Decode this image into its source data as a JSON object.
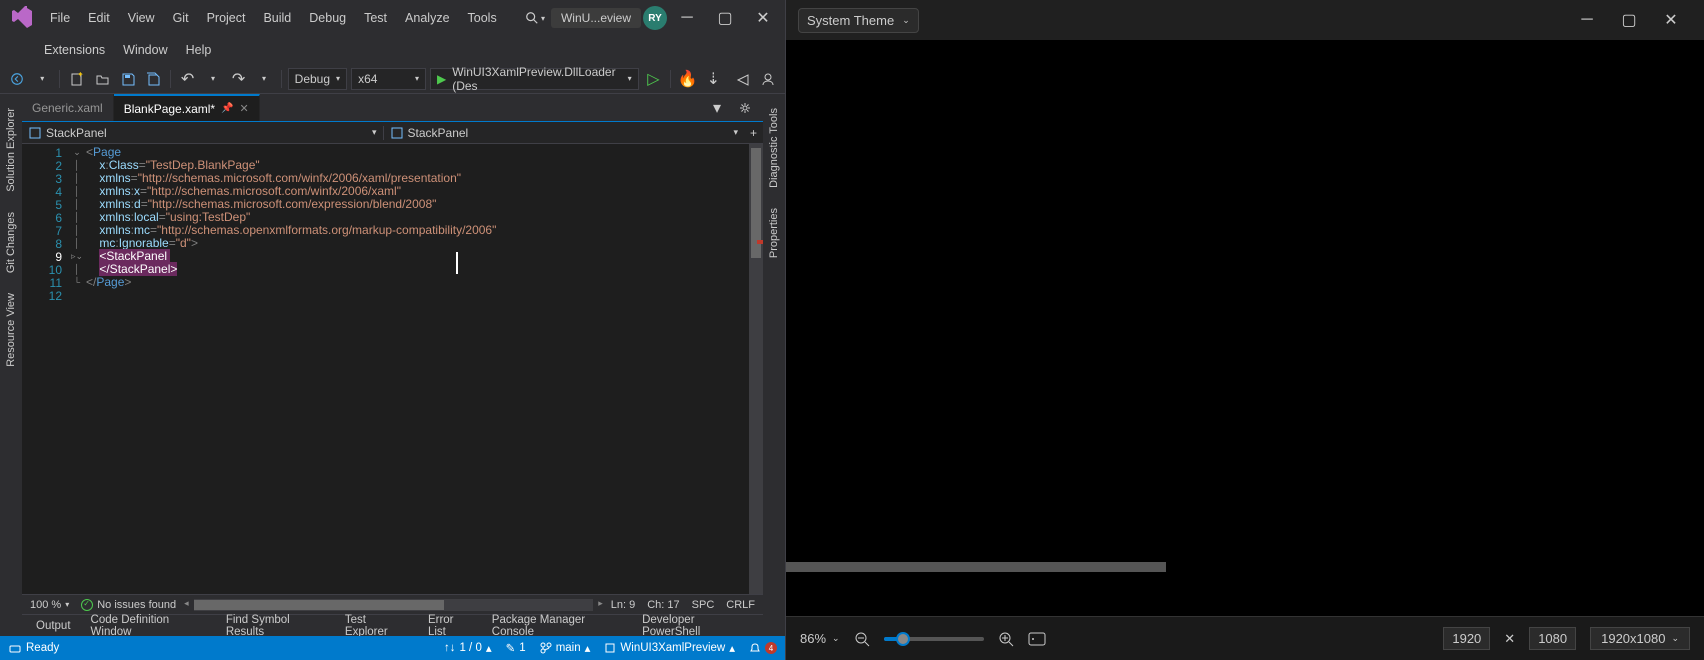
{
  "menu": {
    "items": [
      "File",
      "Edit",
      "View",
      "Git",
      "Project",
      "Build",
      "Debug",
      "Test",
      "Analyze",
      "Tools",
      "Extensions",
      "Window",
      "Help"
    ]
  },
  "title": "WinU...eview",
  "user_initials": "RY",
  "toolbar": {
    "config": "Debug",
    "platform": "x64",
    "target": "WinUI3XamlPreview.DllLoader (Des"
  },
  "tabs": [
    {
      "label": "Generic.xaml",
      "active": false
    },
    {
      "label": "BlankPage.xaml*",
      "active": true
    }
  ],
  "breadcrumbs": {
    "left": "StackPanel",
    "right": "StackPanel"
  },
  "code": {
    "lines": [
      {
        "n": 1,
        "raw": "<Page"
      },
      {
        "n": 2,
        "raw": "    x:Class=\"TestDep.BlankPage\""
      },
      {
        "n": 3,
        "raw": "    xmlns=\"http://schemas.microsoft.com/winfx/2006/xaml/presentation\""
      },
      {
        "n": 4,
        "raw": "    xmlns:x=\"http://schemas.microsoft.com/winfx/2006/xaml\""
      },
      {
        "n": 5,
        "raw": "    xmlns:d=\"http://schemas.microsoft.com/expression/blend/2008\""
      },
      {
        "n": 6,
        "raw": "    xmlns:local=\"using:TestDep\""
      },
      {
        "n": 7,
        "raw": "    xmlns:mc=\"http://schemas.openxmlformats.org/markup-compatibility/2006\""
      },
      {
        "n": 8,
        "raw": "    mc:Ignorable=\"d\">"
      },
      {
        "n": 9,
        "raw": "    <StackPanel "
      },
      {
        "n": 10,
        "raw": "    </StackPanel>"
      },
      {
        "n": 11,
        "raw": "</Page>"
      },
      {
        "n": 12,
        "raw": ""
      }
    ],
    "active_line": 9
  },
  "editor_status": {
    "zoom": "100 %",
    "issues": "No issues found",
    "ln": "Ln: 9",
    "ch": "Ch: 17",
    "indent": "SPC",
    "eol": "CRLF"
  },
  "panels": [
    "Output",
    "Code Definition Window",
    "Find Symbol Results",
    "Test Explorer",
    "Error List",
    "Package Manager Console",
    "Developer PowerShell"
  ],
  "status": {
    "ready": "Ready",
    "updown": "1 / 0",
    "pencil": "1",
    "branch": "main",
    "project": "WinUI3XamlPreview"
  },
  "side_left": [
    "Solution Explorer",
    "Git Changes",
    "Resource View"
  ],
  "side_right": [
    "Diagnostic Tools",
    "Properties"
  ],
  "preview": {
    "theme": "System Theme",
    "zoom": "86%",
    "width": "1920",
    "height": "1080",
    "res": "1920x1080"
  }
}
